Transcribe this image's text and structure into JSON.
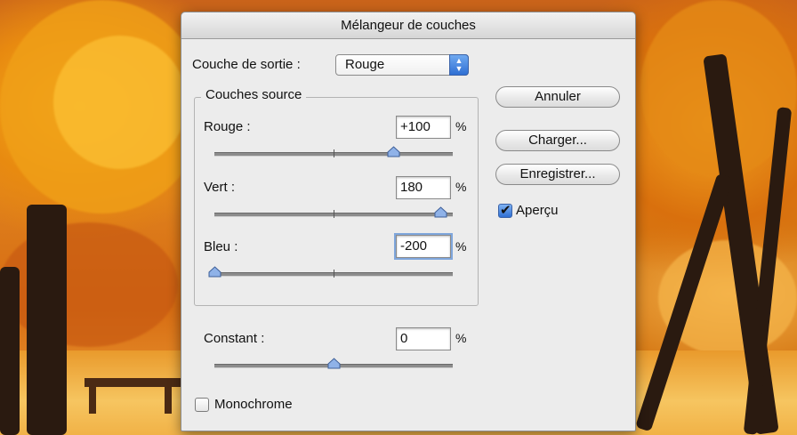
{
  "dialog": {
    "title": "Mélangeur de couches",
    "output_label": "Couche de sortie :",
    "output_value": "Rouge",
    "source_group_label": "Couches source",
    "sources": [
      {
        "label": "Rouge :",
        "value": "+100",
        "unit": "%",
        "slider_fraction": 0.75
      },
      {
        "label": "Vert :",
        "value": "180",
        "unit": "%",
        "slider_fraction": 0.95
      },
      {
        "label": "Bleu :",
        "value": "-200",
        "unit": "%",
        "slider_fraction": 0.0
      }
    ],
    "constant": {
      "label": "Constant :",
      "value": "0",
      "unit": "%",
      "slider_fraction": 0.5
    },
    "monochrome": {
      "label": "Monochrome",
      "checked": false
    },
    "buttons": {
      "cancel": "Annuler",
      "load": "Charger...",
      "save": "Enregistrer..."
    },
    "preview": {
      "label": "Aperçu",
      "checked": true
    }
  },
  "colors": {
    "accent": "#2f6fd3",
    "knob": "#8fb2e8"
  }
}
